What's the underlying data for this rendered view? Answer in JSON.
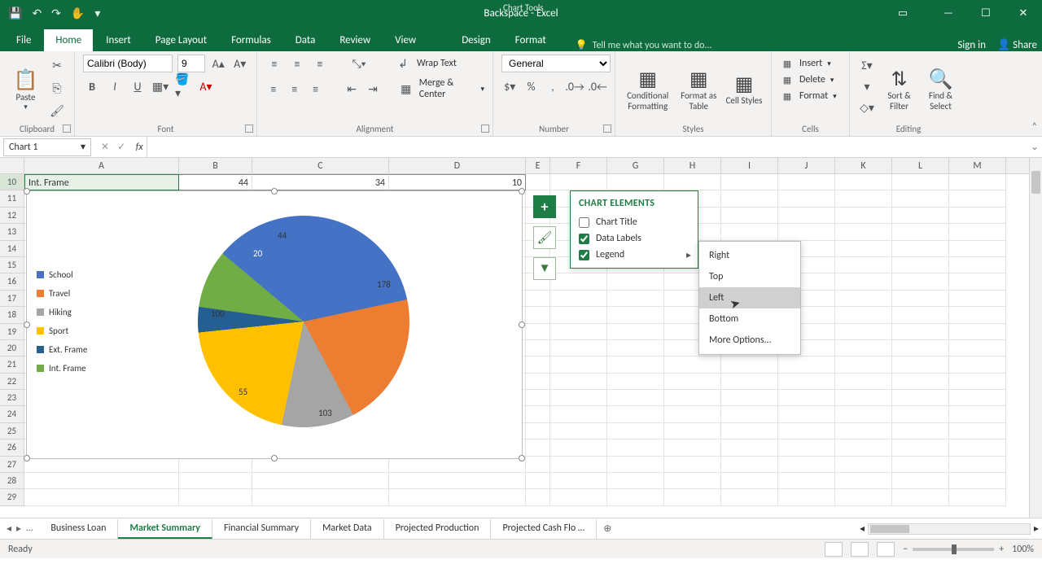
{
  "window": {
    "title": "Backspace - Excel",
    "chart_tools_label": "Chart Tools",
    "sign_in": "Sign in",
    "share": "Share"
  },
  "qat": {
    "save": "💾",
    "undo": "↶",
    "redo": "↷",
    "touch": "✋"
  },
  "tabs": {
    "file": "File",
    "home": "Home",
    "insert": "Insert",
    "page_layout": "Page Layout",
    "formulas": "Formulas",
    "data": "Data",
    "review": "Review",
    "view": "View",
    "design": "Design",
    "format": "Format",
    "tellme": "Tell me what you want to do..."
  },
  "ribbon": {
    "clipboard": {
      "paste": "Paste",
      "label": "Clipboard"
    },
    "font": {
      "font_name": "Calibri (Body)",
      "font_size": "9",
      "bold": "B",
      "italic": "I",
      "underline": "U",
      "label": "Font"
    },
    "alignment": {
      "wrap": "Wrap Text",
      "merge": "Merge & Center",
      "label": "Alignment"
    },
    "number": {
      "format": "General",
      "label": "Number"
    },
    "styles": {
      "cond": "Conditional Formatting",
      "table": "Format as Table",
      "cell": "Cell Styles",
      "label": "Styles"
    },
    "cells": {
      "insert": "Insert",
      "delete": "Delete",
      "format": "Format",
      "label": "Cells"
    },
    "editing": {
      "sort": "Sort & Filter",
      "find": "Find & Select",
      "label": "Editing"
    }
  },
  "namebox": "Chart 1",
  "columns": [
    "A",
    "B",
    "C",
    "D",
    "E",
    "F",
    "G",
    "H",
    "I",
    "J",
    "K",
    "L",
    "M"
  ],
  "row10": {
    "a": "Int. Frame",
    "b": "44",
    "c": "34",
    "d": "10"
  },
  "row_start": 10,
  "row_end": 29,
  "legend_items": [
    {
      "label": "School",
      "color": "#4472c4"
    },
    {
      "label": "Travel",
      "color": "#ed7d31"
    },
    {
      "label": "Hiking",
      "color": "#a5a5a5"
    },
    {
      "label": "Sport",
      "color": "#ffc000"
    },
    {
      "label": "Ext. Frame",
      "color": "#255e91"
    },
    {
      "label": "Int. Frame",
      "color": "#70ad47"
    }
  ],
  "chart_elements": {
    "title": "CHART ELEMENTS",
    "items": [
      {
        "label": "Chart Title",
        "checked": false,
        "submenu": false
      },
      {
        "label": "Data Labels",
        "checked": true,
        "submenu": false
      },
      {
        "label": "Legend",
        "checked": true,
        "submenu": true
      }
    ]
  },
  "submenu": {
    "items": [
      "Right",
      "Top",
      "Left",
      "Bottom",
      "More Options..."
    ],
    "hover_index": 2
  },
  "sheet_tabs": [
    "Business Loan",
    "Market Summary",
    "Financial Summary",
    "Market Data",
    "Projected Production",
    "Projected Cash Flo …"
  ],
  "sheet_active_index": 1,
  "status": {
    "ready": "Ready",
    "zoom": "100%"
  },
  "chart_data": {
    "type": "pie",
    "title": "",
    "categories": [
      "School",
      "Travel",
      "Hiking",
      "Sport",
      "Ext. Frame",
      "Int. Frame"
    ],
    "values": [
      178,
      103,
      55,
      100,
      20,
      44
    ],
    "colors": [
      "#4472c4",
      "#ed7d31",
      "#a5a5a5",
      "#ffc000",
      "#255e91",
      "#70ad47"
    ],
    "data_labels": true,
    "legend_position": "left"
  }
}
